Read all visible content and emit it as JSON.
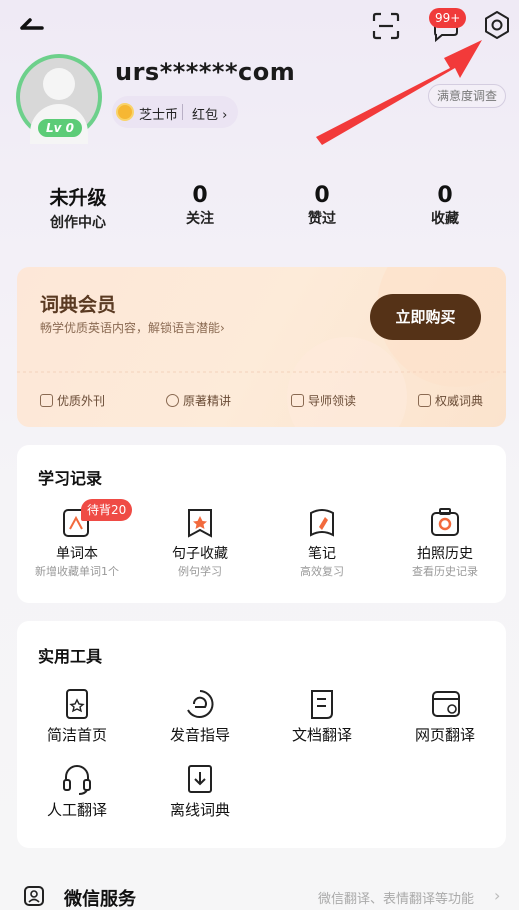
{
  "header": {
    "notification_badge": "99+"
  },
  "profile": {
    "username": "urs******com",
    "level": "Lv 0",
    "coin_label": "芝士币",
    "hongbao_label": "红包",
    "survey_label": "满意度调查"
  },
  "stats": [
    {
      "value": "未升级",
      "label": "创作中心"
    },
    {
      "value": "0",
      "label": "关注"
    },
    {
      "value": "0",
      "label": "赞过"
    },
    {
      "value": "0",
      "label": "收藏"
    }
  ],
  "vip": {
    "title": "词典会员",
    "subtitle": "畅学优质英语内容，解锁语言潜能",
    "buy_label": "立即购买",
    "features": [
      "优质外刊",
      "原著精讲",
      "导师领读",
      "权威词典"
    ]
  },
  "study": {
    "title": "学习记录",
    "pending_badge": "待背20",
    "items": [
      {
        "label": "单词本",
        "sub": "新增收藏单词1个",
        "icon": "wordbook-icon"
      },
      {
        "label": "句子收藏",
        "sub": "例句学习",
        "icon": "sentence-icon"
      },
      {
        "label": "笔记",
        "sub": "高效复习",
        "icon": "note-icon"
      },
      {
        "label": "拍照历史",
        "sub": "查看历史记录",
        "icon": "camera-icon"
      }
    ]
  },
  "tools": {
    "title": "实用工具",
    "items": [
      {
        "label": "简洁首页",
        "icon": "phone-icon"
      },
      {
        "label": "发音指导",
        "icon": "pronunciation-icon"
      },
      {
        "label": "文档翻译",
        "icon": "document-icon"
      },
      {
        "label": "网页翻译",
        "icon": "webpage-icon"
      },
      {
        "label": "人工翻译",
        "icon": "headset-icon"
      },
      {
        "label": "离线词典",
        "icon": "download-book-icon"
      }
    ]
  },
  "wechat": {
    "title": "微信服务",
    "desc": "微信翻译、表情翻译等功能"
  },
  "colors": {
    "accent_red": "#f03a3a",
    "level_green": "#5ccc77",
    "buy_button": "#553217",
    "icon_orange": "#f26a3d"
  }
}
